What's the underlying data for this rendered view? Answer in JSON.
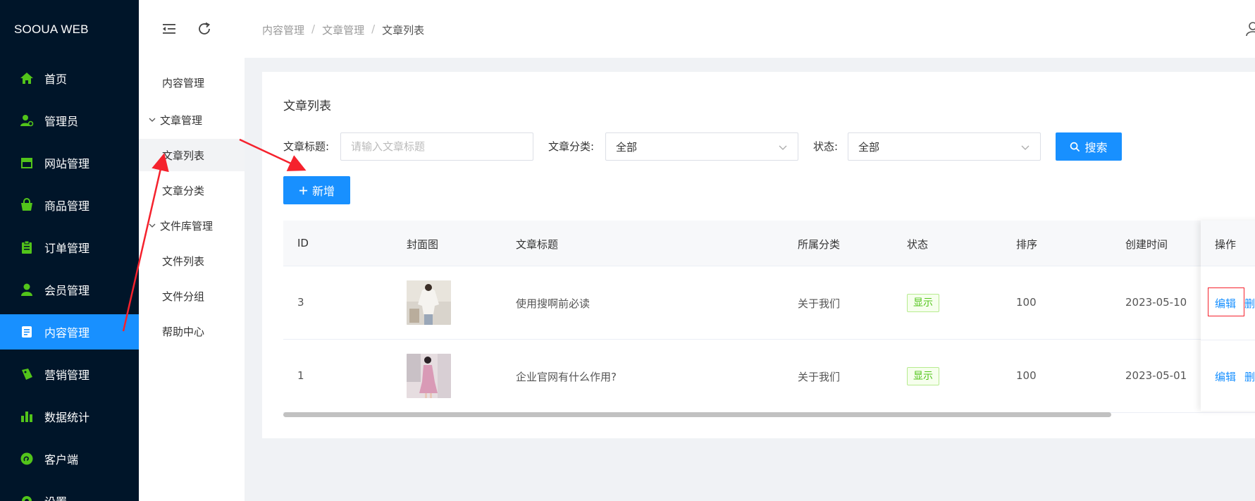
{
  "brand": "SOOUA WEB",
  "sidebar": {
    "items": [
      {
        "label": "首页",
        "icon": "home-icon"
      },
      {
        "label": "管理员",
        "icon": "admin-icon"
      },
      {
        "label": "网站管理",
        "icon": "store-icon"
      },
      {
        "label": "商品管理",
        "icon": "shopping-bag-icon"
      },
      {
        "label": "订单管理",
        "icon": "clipboard-icon"
      },
      {
        "label": "会员管理",
        "icon": "user-icon"
      },
      {
        "label": "内容管理",
        "icon": "document-icon",
        "active": true
      },
      {
        "label": "营销管理",
        "icon": "tag-icon"
      },
      {
        "label": "数据统计",
        "icon": "bar-chart-icon"
      },
      {
        "label": "客户端",
        "icon": "client-icon"
      },
      {
        "label": "设置",
        "icon": "gear-icon"
      }
    ],
    "accent": "#1890ff",
    "icon_color": "#52c41a"
  },
  "subnav": {
    "items": [
      {
        "label": "内容管理",
        "type": "item"
      },
      {
        "label": "文章管理",
        "type": "group"
      },
      {
        "label": "文章列表",
        "type": "item",
        "active": true
      },
      {
        "label": "文章分类",
        "type": "item"
      },
      {
        "label": "文件库管理",
        "type": "group"
      },
      {
        "label": "文件列表",
        "type": "item"
      },
      {
        "label": "文件分组",
        "type": "item"
      },
      {
        "label": "帮助中心",
        "type": "item"
      }
    ]
  },
  "header": {
    "breadcrumb": [
      "内容管理",
      "文章管理",
      "文章列表"
    ],
    "separator": "/"
  },
  "card": {
    "title": "文章列表",
    "filters": {
      "title_label": "文章标题:",
      "title_placeholder": "请输入文章标题",
      "category_label": "文章分类:",
      "category_value": "全部",
      "status_label": "状态:",
      "status_value": "全部"
    },
    "search_label": "搜索",
    "add_label": "新增"
  },
  "table": {
    "columns": [
      "ID",
      "封面图",
      "文章标题",
      "所属分类",
      "状态",
      "排序",
      "创建时间",
      "操作"
    ],
    "rows": [
      {
        "id": "3",
        "title": "使用搜啊前必读",
        "category": "关于我们",
        "status": "显示",
        "sort": "100",
        "created": "2023-05-10",
        "edit": "编辑",
        "delete": "删除"
      },
      {
        "id": "1",
        "title": "企业官网有什么作用?",
        "category": "关于我们",
        "status": "显示",
        "sort": "100",
        "created": "2023-05-01",
        "edit": "编辑",
        "delete": "删除"
      }
    ],
    "status_color": "#52c41a",
    "link_color": "#1890ff"
  }
}
